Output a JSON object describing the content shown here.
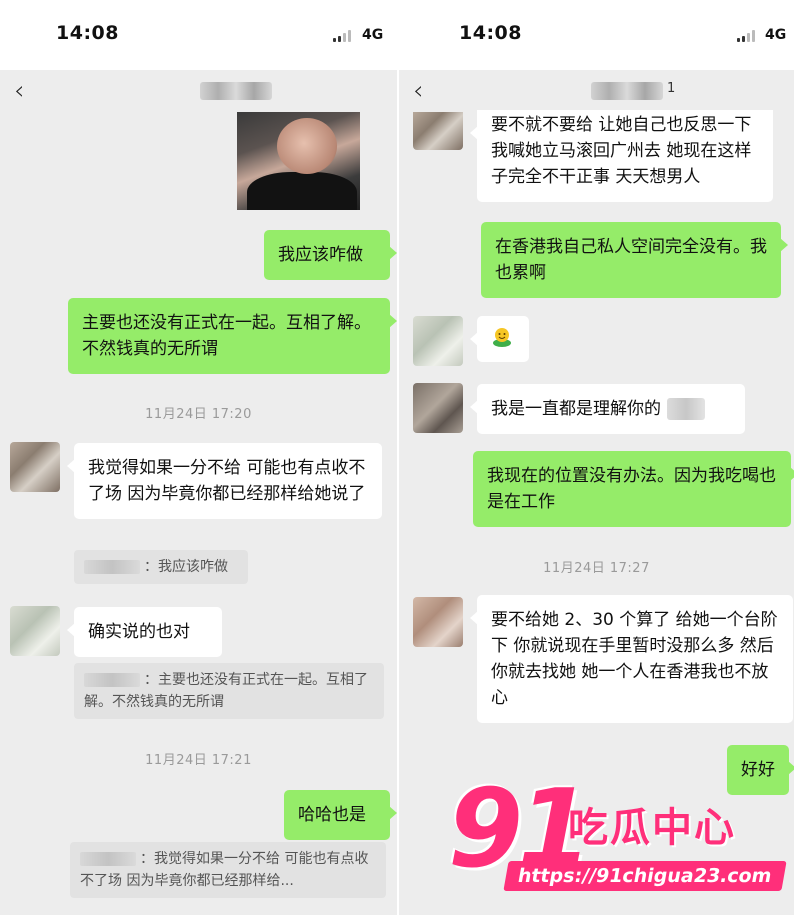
{
  "left": {
    "status": {
      "time": "14:08",
      "network": "4G"
    },
    "messages": {
      "m1": "我应该咋做",
      "m2": "主要也还没有正式在一起。互相了解。不然钱真的无所谓",
      "stamp1": "11月24日 17:20",
      "m3": "我觉得如果一分不给 可能也有点收不了场 因为毕竟你都已经那样给她说了",
      "q1": "：我应该咋做",
      "m4": "确实说的也对",
      "q2": "：主要也还没有正式在一起。互相了解。不然钱真的无所谓",
      "stamp2": "11月24日 17:21",
      "m5": "哈哈也是",
      "q3": "：我觉得如果一分不给 可能也有点收不了场 因为毕竟你都已经那样给..."
    }
  },
  "right": {
    "status": {
      "time": "14:08",
      "network": "4G"
    },
    "title_suffix": "1",
    "messages": {
      "m1": "要不就不要给 让她自己也反思一下 我喊她立马滚回广州去 她现在这样子完全不干正事 天天想男人",
      "m2": "在香港我自己私人空间完全没有。我也累啊",
      "m3_icon": "smiling-emoji-icon",
      "m4": "我是一直都是理解你的",
      "m5": "我现在的位置没有办法。因为我吃喝也是在工作",
      "stamp1": "11月24日 17:27",
      "m6": "要不给她 2、30 个算了 给她一个台阶下 你就说现在手里暂时没那么多 然后你就去找她 她一个人在香港我也不放心",
      "m7": "好好"
    }
  },
  "watermark": {
    "number": "91",
    "brand": "吃瓜中心",
    "url": "https://91chigua23.com"
  },
  "colors": {
    "sent_bubble": "#95ec69",
    "received_bubble": "#ffffff",
    "background": "#ededed",
    "watermark": "#ff2f7a"
  }
}
